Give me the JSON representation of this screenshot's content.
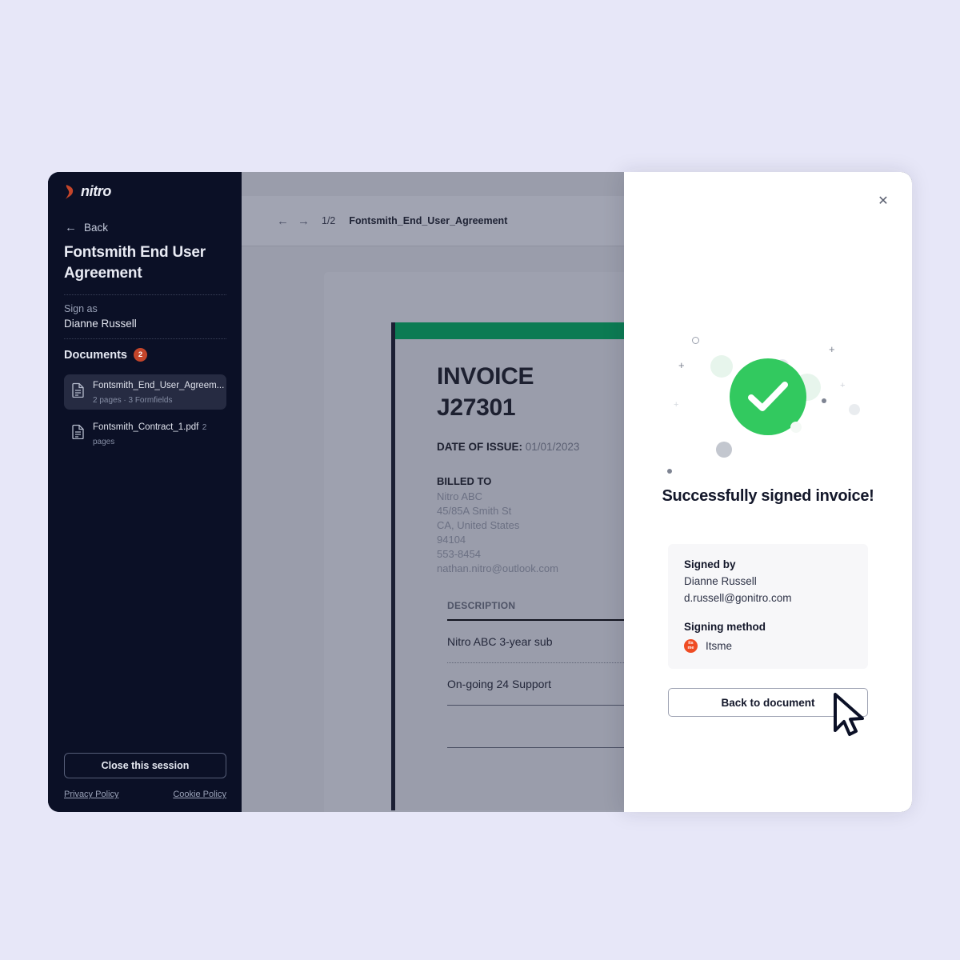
{
  "background_color": "#e7e7f8",
  "brand": {
    "logo_text": "nitro",
    "logo_icon": "nitro-flame-icon",
    "accent_color": "#c4452a"
  },
  "sidebar": {
    "back": {
      "label": "Back",
      "icon": "arrow-left-icon"
    },
    "document_title": "Fontsmith End User Agreement",
    "sign_as_label": "Sign as",
    "sign_as_name": "Dianne Russell",
    "documents_heading": "Documents",
    "documents_count": "2",
    "documents": [
      {
        "name": "Fontsmith_End_User_Agreem...",
        "meta": "2 pages · 3 Formfields",
        "icon": "document-icon",
        "selected": true
      },
      {
        "name": "Fontsmith_Contract_1.pdf",
        "meta": "2 pages",
        "icon": "document-icon",
        "selected": false
      }
    ],
    "close_session_label": "Close this session",
    "privacy_policy_label": "Privacy Policy",
    "cookie_policy_label": "Cookie Policy"
  },
  "viewer": {
    "prev_icon": "arrow-left-icon",
    "next_icon": "arrow-right-icon",
    "page_indicator": "1/2",
    "filename": "Fontsmith_End_User_Agreement",
    "invoice": {
      "accent_bar_color": "#0c7b53",
      "title_line1": "INVOICE",
      "title_line2": "J27301",
      "date_label": "DATE OF ISSUE:",
      "date_value": "01/01/2023",
      "billed_to_label": "BILLED TO",
      "billed_to_lines": [
        "Nitro ABC",
        "45/85A Smith St",
        "CA, United States",
        "94104",
        "553-8454",
        "nathan.nitro@outlook.com"
      ],
      "table_header": "DESCRIPTION",
      "table_rows": [
        "Nitro ABC 3-year sub",
        "On-going 24 Support",
        ""
      ]
    }
  },
  "modal": {
    "close_icon": "close-icon",
    "success_icon": "check-circle-icon",
    "success_color": "#32c95f",
    "heading": "Successfully signed invoice!",
    "signed_by_label": "Signed by",
    "signed_by_name": "Dianne Russell",
    "signed_by_email": "d.russell@gonitro.com",
    "signing_method_label": "Signing method",
    "signing_method_value": "Itsme",
    "signing_method_icon": "itsme-icon",
    "signing_method_color": "#ef4c23",
    "primary_button_label": "Back to document"
  },
  "cursor": {
    "icon": "mouse-pointer-icon"
  }
}
